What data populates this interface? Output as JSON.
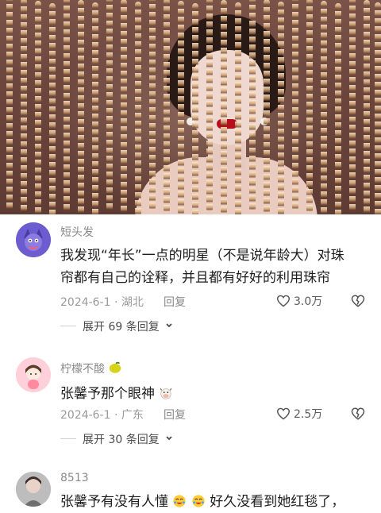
{
  "comments": [
    {
      "username": "短头发",
      "text_line1": "我发现“年长”一点的明星（不是说年龄大）对珠",
      "text_line2": "帘都有自己的诠释，并且都有好好的利用珠帘",
      "date_location": "2024-6-1 · 湖北",
      "reply_label": "回复",
      "likes": "3.0万",
      "expand_label": "展开 69 条回复"
    },
    {
      "username": "柠檬不酸",
      "text": "张馨予那个眼神",
      "date_location": "2024-6-1 · 广东",
      "reply_label": "回复",
      "likes": "2.5万",
      "expand_label": "展开 30 条回复"
    },
    {
      "username": "8513",
      "text": "张馨予有没有人懂",
      "text_tail": "好久没看到她红毯了，"
    }
  ],
  "icons": {
    "avatar1": "cartoon-avatar",
    "avatar2": "girl-avatar",
    "avatar3": "photo-avatar",
    "lemon": "lemon-emoji",
    "cow": "cow-emoji",
    "heart": "heart-outline-icon",
    "broken_heart": "broken-heart-icon",
    "chevron": "chevron-down-icon"
  },
  "colors": {
    "text": "#1d1d1d",
    "muted": "#9a9a9a"
  }
}
